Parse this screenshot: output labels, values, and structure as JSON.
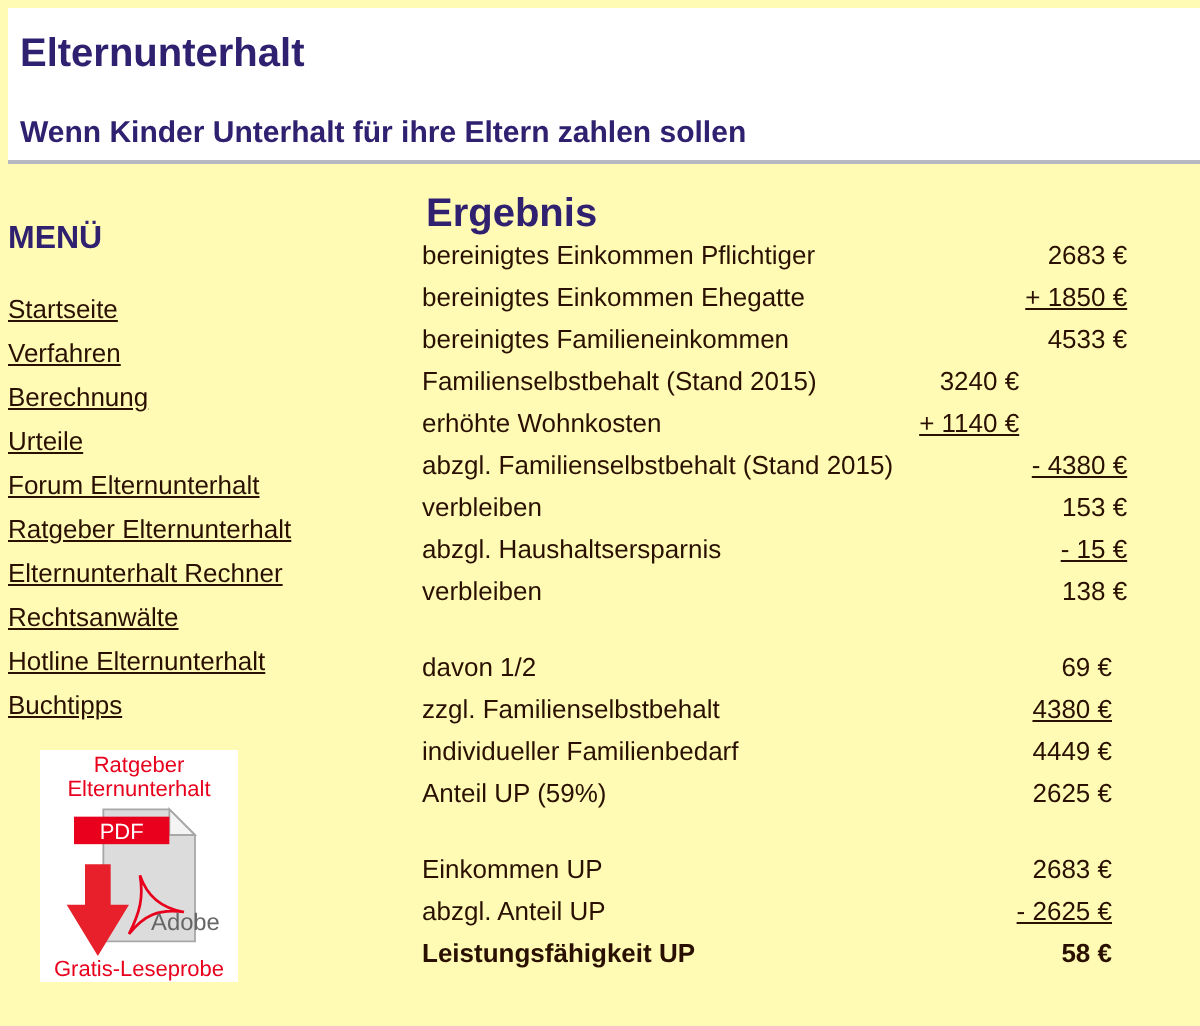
{
  "header": {
    "title": "Elternunterhalt",
    "subtitle": "Wenn Kinder Unterhalt für ihre Eltern zahlen sollen"
  },
  "menu": {
    "heading": "MENÜ",
    "items": [
      "Startseite",
      "Verfahren",
      "Berechnung",
      "Urteile",
      "Forum Elternunterhalt",
      "Ratgeber Elternunterhalt",
      "Elternunterhalt Rechner",
      "Rechtsanwälte",
      "Hotline Elternunterhalt",
      "Buchtipps"
    ],
    "banner": {
      "top": "Ratgeber Elternunterhalt",
      "badge": "PDF",
      "logo": "Adobe",
      "bottom": "Gratis-Leseprobe"
    }
  },
  "result": {
    "heading": "Ergebnis",
    "groups": [
      [
        {
          "label": "bereinigtes Einkommen Pflichtiger",
          "value": "2683 €",
          "kind": "outer",
          "underlined": false,
          "bold": false
        },
        {
          "label": "bereinigtes Einkommen Ehegatte",
          "value": "+ 1850 €",
          "kind": "outer",
          "underlined": true,
          "bold": false
        },
        {
          "label": "bereinigtes Familieneinkommen",
          "value": "4533 €",
          "kind": "outer",
          "underlined": false,
          "bold": false
        },
        {
          "label": "Familienselbstbehalt (Stand 2015)",
          "value": "3240 €",
          "kind": "inner",
          "underlined": false,
          "bold": false
        },
        {
          "label": "erhöhte Wohnkosten",
          "value": "+ 1140 €",
          "kind": "inner",
          "underlined": true,
          "bold": false
        },
        {
          "label": "abzgl. Familienselbstbehalt (Stand 2015)",
          "value": "- 4380 €",
          "kind": "outer",
          "underlined": true,
          "bold": false
        },
        {
          "label": "verbleiben",
          "value": "153 €",
          "kind": "outer",
          "underlined": false,
          "bold": false
        },
        {
          "label": "abzgl. Haushaltsersparnis",
          "value": "- 15 €",
          "kind": "outer",
          "underlined": true,
          "bold": false
        },
        {
          "label": "verbleiben",
          "value": "138 €",
          "kind": "outer",
          "underlined": false,
          "bold": false
        }
      ],
      [
        {
          "label": "davon 1/2",
          "value": "69 €",
          "kind": "outer",
          "underlined": false,
          "bold": false
        },
        {
          "label": "zzgl. Familienselbstbehalt",
          "value": "4380 €",
          "kind": "outer",
          "underlined": true,
          "bold": false
        },
        {
          "label": "individueller Familienbedarf",
          "value": "4449 €",
          "kind": "outer",
          "underlined": false,
          "bold": false
        },
        {
          "label": "Anteil UP (59%)",
          "value": "2625 €",
          "kind": "outer",
          "underlined": false,
          "bold": false
        }
      ],
      [
        {
          "label": "Einkommen UP",
          "value": "2683 €",
          "kind": "outer",
          "underlined": false,
          "bold": false
        },
        {
          "label": "abzgl. Anteil UP",
          "value": "- 2625 €",
          "kind": "outer",
          "underlined": true,
          "bold": false
        },
        {
          "label": "Leistungsfähigkeit UP",
          "value": "58 €",
          "kind": "outer",
          "underlined": false,
          "bold": true
        }
      ]
    ]
  }
}
